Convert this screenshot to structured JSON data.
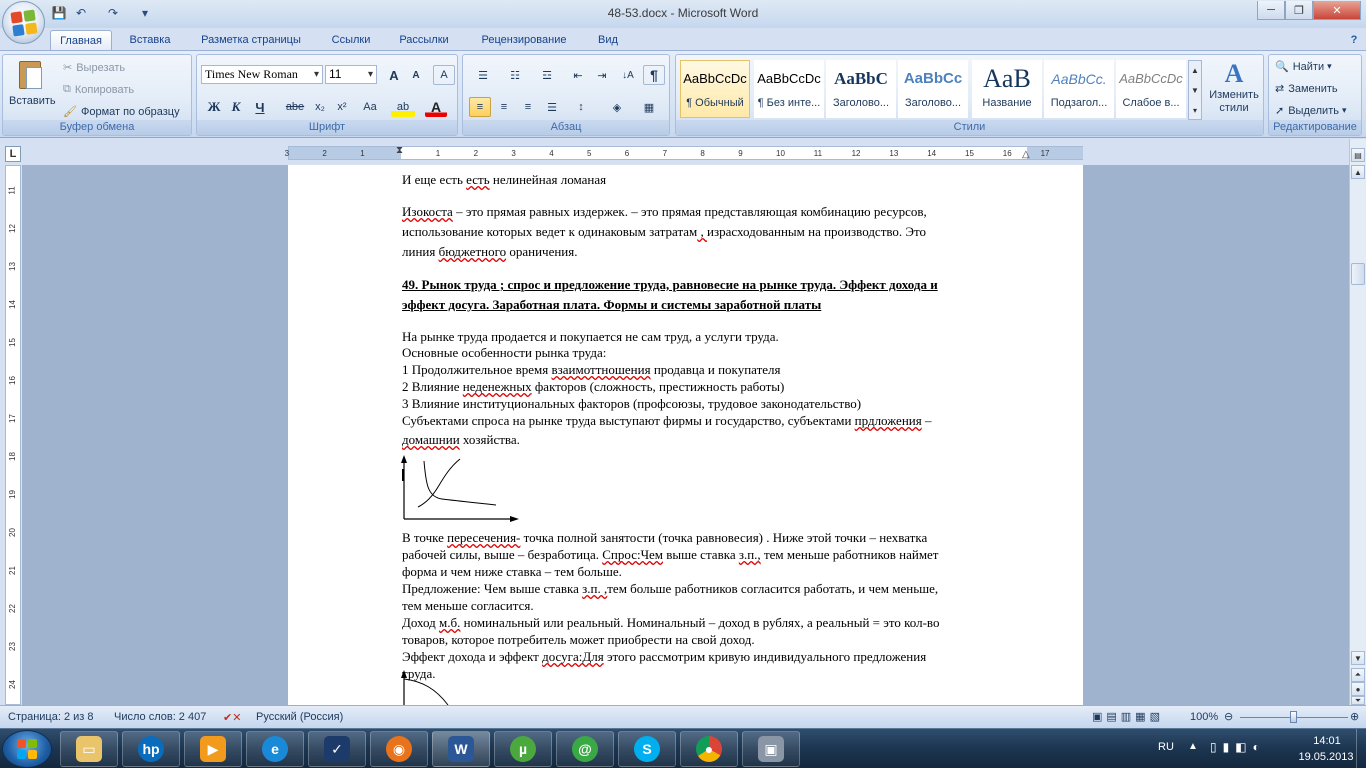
{
  "window": {
    "title": "48-53.docx - Microsoft Word",
    "minimize": "─",
    "maximize": "❐",
    "close": "✕"
  },
  "qat": {
    "save": "💾",
    "undo": "↶",
    "redo": "↷",
    "customize": "▾"
  },
  "tabs": [
    "Главная",
    "Вставка",
    "Разметка страницы",
    "Ссылки",
    "Рассылки",
    "Рецензирование",
    "Вид"
  ],
  "help_icon": "?",
  "clipboard": {
    "paste": "Вставить",
    "cut": "Вырезать",
    "copy": "Копировать",
    "format_painter": "Формат по образцу",
    "label": "Буфер обмена"
  },
  "font": {
    "name": "Times New Roman",
    "size": "11",
    "grow": "A",
    "shrink": "A",
    "bold": "Ж",
    "italic": "К",
    "underline": "Ч",
    "strike": "abe",
    "subscript": "x₂",
    "superscript": "x²",
    "case": "Aa",
    "highlight": "ab",
    "color": "A",
    "clear": "A",
    "label": "Шрифт"
  },
  "paragraph": {
    "label": "Абзац",
    "pilcrow": "¶",
    "sort": "↓A"
  },
  "styles": {
    "label": "Стили",
    "items": [
      {
        "preview": "AaBbCcDc",
        "name": "¶ Обычный"
      },
      {
        "preview": "AaBbCcDc",
        "name": "¶ Без инте..."
      },
      {
        "preview": "AaBbC",
        "name": "Заголово..."
      },
      {
        "preview": "AaBbCc",
        "name": "Заголово..."
      },
      {
        "preview": "AaB",
        "name": "Название"
      },
      {
        "preview": "AaBbCc.",
        "name": "Подзагол..."
      },
      {
        "preview": "AaBbCcDc",
        "name": "Слабое в..."
      }
    ],
    "change": "Изменить",
    "change2": "стили"
  },
  "editing": {
    "label": "Редактирование",
    "find": "Найти",
    "replace": "Заменить",
    "select": "Выделить"
  },
  "ruler": {
    "h_marks": [
      "3",
      "2",
      "1",
      "1",
      "2",
      "3",
      "4",
      "5",
      "6",
      "7",
      "8",
      "9",
      "10",
      "11",
      "12",
      "13",
      "14",
      "15",
      "16",
      "17"
    ],
    "v_marks": [
      "11",
      "12",
      "13",
      "14",
      "15",
      "16",
      "17",
      "18",
      "19",
      "20",
      "21",
      "22",
      "23",
      "24"
    ]
  },
  "document": {
    "line1": "И еще есть ",
    "line1_sq": "есть",
    "line1_end": " нелинейная ломаная",
    "p2_l1_sq": "Изокоста",
    "p2_l1": " – это прямая равных издержек. – это прямая представляющая комбинацию ресурсов,",
    "p2_l2a": "использование которых ведет к одинаковым затратам",
    "p2_l2_sq": " , ",
    "p2_l2b": "израсходованным на производство. Это",
    "p2_l3a": "линия ",
    "p2_l3_sq": "бюджетного",
    "p2_l3b": " ораничения.",
    "h1": "49. Рынок труда ; спрос и предложение труда, равновесие на рынке труда. Эффект дохода и",
    "h2": "эффект  досуга. Заработная плата. Формы и системы заработной платы",
    "b1": "На рынке труда продается и покупается не сам труд, а услуги труда.",
    "b2": "Основные особенности рынка труда:",
    "b3a": "1 Продолжительное время ",
    "b3_sq": "взаимоттношения",
    "b3b": " продавца и покупателя",
    "b4a": "2 Влияние ",
    "b4_sq": "неденежных",
    "b4b": " факторов (сложность, престижность работы)",
    "b5": "3 Влияние институциональных факторов (профсоюзы, трудовое законодательство)",
    "b6a": "Субъектами спроса на рынке труда выступают фирмы и государство, субъектами ",
    "b6_sq": "прдложения",
    "b6b": " –",
    "b7_sq": "домашнии",
    "b7b": " хозяйства.",
    "c1a": "В точке ",
    "c1_sq": "пересечения-",
    "c1b": " точка полной занятости (точка равновесия) . Ниже этой точки – нехватка",
    "c2a": "рабочей силы, выше – безработица. ",
    "c2_sq": "Спрос:Чем",
    "c2b": " выше ставка ",
    "c2_sq2": "з.п.,",
    "c2c": " тем меньше работников наймет",
    "c3": "форма и чем ниже ставка – тем больше.",
    "c4a": "Предложение: Чем выше ставка ",
    "c4_sq": "з.п. ,",
    "c4b": "тем больше работников согласится работать, и чем меньше,",
    "c5": "тем меньше согласится.",
    "c6a": " Доход ",
    "c6_sq": "м.б.",
    "c6b": " номинальный или реальный. Номинальный – доход в рублях, а реальный = это кол-во",
    "c7": "товаров, которое потребитель может приобрести на свой доход.",
    "c8a": "Эффект дохода и эффект ",
    "c8_sq": "досуга:Для",
    "c8b": " этого рассмотрим кривую индивидуального предложения",
    "c9": "труда."
  },
  "status": {
    "page": "Страница: 2 из 8",
    "words": "Число слов: 2 407",
    "lang": "Русский (Россия)",
    "zoom": "100%"
  },
  "tray": {
    "lang": "RU",
    "time": "14:01",
    "date": "19.05.2013"
  }
}
